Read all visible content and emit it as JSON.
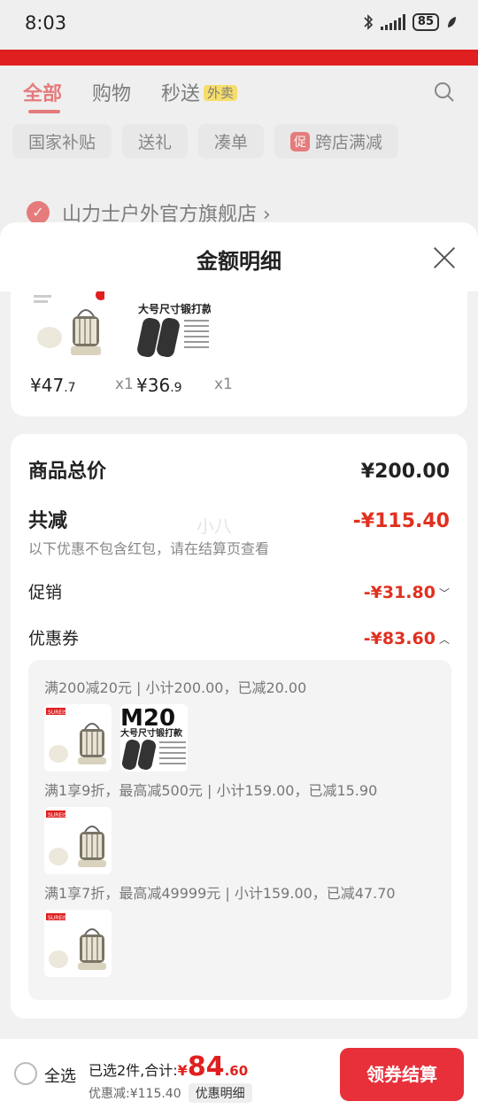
{
  "status": {
    "time": "8:03",
    "battery": "85"
  },
  "bg": {
    "tabs": [
      {
        "label": "全部"
      },
      {
        "label": "购物"
      },
      {
        "label": "秒送",
        "badge": "外卖"
      }
    ],
    "chips": [
      "国家补贴",
      "送礼",
      "凑单",
      "跨店满减"
    ],
    "promo_mark": "促",
    "store_name": "山力士户外官方旗舰店 ›"
  },
  "sheet": {
    "title": "金额明细",
    "products": [
      {
        "price_int": "¥47",
        "price_dec": ".7",
        "qty": "x1"
      },
      {
        "price_int": "¥36",
        "price_dec": ".9",
        "qty": "x1"
      }
    ],
    "summary": {
      "total_label": "商品总价",
      "total_value": "¥200.00",
      "reduce_label": "共减",
      "reduce_value": "-¥115.40",
      "reduce_note": "以下优惠不包含红包，请在结算页查看",
      "promo_label": "促销",
      "promo_value": "-¥31.80",
      "coupon_label": "优惠券",
      "coupon_value": "-¥83.60"
    },
    "coupons": [
      {
        "text": "满200减20元 | 小计200.00，已减20.00"
      },
      {
        "text": "满1享9折，最高减500元 | 小计159.00，已减15.90"
      },
      {
        "text": "满1享7折，最高减49999元 | 小计159.00，已减47.70"
      }
    ],
    "product_art": {
      "m20_title": "M20",
      "m20_sub": "大号尺寸锻打款",
      "brand": "SUREIS"
    },
    "watermark": "小八"
  },
  "bottom": {
    "select_all": "全选",
    "selected_text": "已选2件,合计:",
    "yen": "¥",
    "total_int": "84",
    "total_dec": ".60",
    "discount_text": "优惠减:¥115.40",
    "detail_btn": "优惠明细",
    "checkout": "领券结算"
  }
}
